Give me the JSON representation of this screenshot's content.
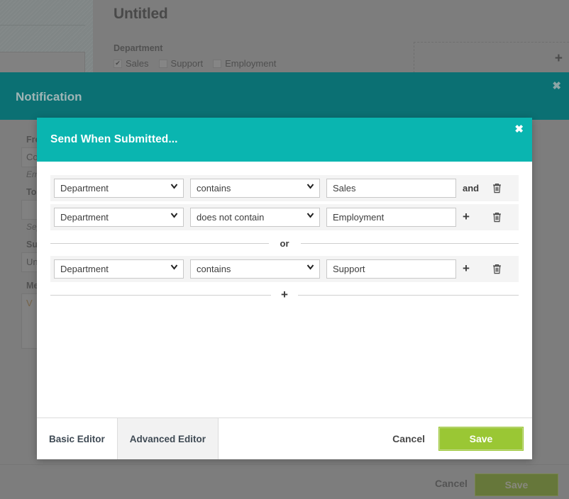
{
  "background": {
    "page_title": "Untitled",
    "department_label": "Department",
    "department_options": [
      {
        "label": "Sales",
        "checked": true
      },
      {
        "label": "Support",
        "checked": false
      },
      {
        "label": "Employment",
        "checked": false
      }
    ],
    "dropzone_icon": "plus-icon",
    "form": {
      "from_label": "From",
      "from_value": "Co",
      "from_hint": "Ema",
      "to_label": "To",
      "to_value": "",
      "to_hint": "Sep",
      "subject_label": "Subj",
      "subject_value": "Un",
      "message_label": "Mes",
      "message_value": "V"
    },
    "footer": {
      "cancel_label": "Cancel",
      "save_label": "Save"
    }
  },
  "back_dialog": {
    "title": "Notification",
    "close_icon": "close-icon"
  },
  "dialog": {
    "title": "Send When Submitted...",
    "close_icon": "close-icon",
    "rule_groups": [
      {
        "rules": [
          {
            "field": "Department",
            "operator": "contains",
            "value": "Sales",
            "conjunction": "and",
            "add_icon": "",
            "delete_icon": "trash-icon"
          },
          {
            "field": "Department",
            "operator": "does not contain",
            "value": "Employment",
            "conjunction": "",
            "add_icon": "plus-icon",
            "delete_icon": "trash-icon"
          }
        ]
      },
      {
        "rules": [
          {
            "field": "Department",
            "operator": "contains",
            "value": "Support",
            "conjunction": "",
            "add_icon": "plus-icon",
            "delete_icon": "trash-icon"
          }
        ]
      }
    ],
    "group_separator_label": "or",
    "group_add_label": "+",
    "tabs": [
      {
        "label": "Basic Editor",
        "active": true
      },
      {
        "label": "Advanced Editor",
        "active": false
      }
    ],
    "cancel_label": "Cancel",
    "save_label": "Save"
  },
  "colors": {
    "header_teal": "#0ab5b0",
    "back_header_teal": "#0b7073",
    "save_green": "#9ac734",
    "row_gray": "#f4f4f4"
  }
}
